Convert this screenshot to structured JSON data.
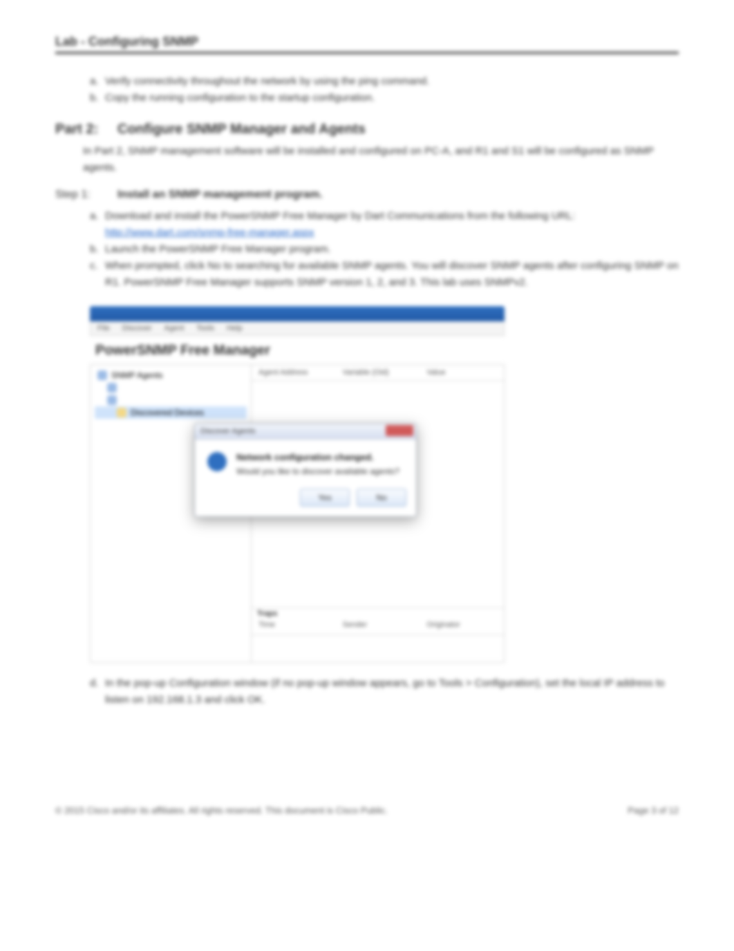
{
  "header": {
    "title": "Lab - Configuring SNMP"
  },
  "top_list": {
    "a": "Verify connectivity throughout the network by using the ping command.",
    "b": "Copy the running configuration to the startup configuration."
  },
  "part": {
    "label": "Part 2:",
    "title": "Configure SNMP Manager and Agents",
    "desc": "In Part 2, SNMP management software will be installed and configured on PC-A, and R1 and S1 will be configured as SNMP agents."
  },
  "step": {
    "label": "Step 1:",
    "title": "Install an SNMP management program."
  },
  "items": {
    "a": "Download and install the PowerSNMP Free Manager by Dart Communications from the following URL:",
    "link": "http://www.dart.com/snmp-free-manager.aspx",
    "b": "Launch the PowerSNMP Free Manager program.",
    "c": "When prompted, click No to searching for available SNMP agents. You will discover SNMP agents after configuring SNMP on R1. PowerSNMP Free Manager supports SNMP version 1, 2, and 3. This lab uses SNMPv2.",
    "d": "In the pop-up Configuration window (if no pop-up window appears, go to Tools > Configuration), set the local IP address to listen on 192.168.1.3 and click OK."
  },
  "app": {
    "menus": [
      "File",
      "Discover",
      "Agent",
      "Tools",
      "Help"
    ],
    "brand": "PowerSNMP Free Manager",
    "cols": [
      "Agent Address",
      "Variable (Oid)",
      "Value"
    ],
    "bottom_cols": [
      "Time",
      "Sender",
      "Originator"
    ],
    "bottom_hdr": "Traps",
    "tree0": "SNMP Agents",
    "tree1": "Discovered Devices"
  },
  "dialog": {
    "title": "Discover Agents",
    "line1": "Network configuration changed.",
    "line2": "Would you like to discover available agents?",
    "yes": "Yes",
    "no": "No"
  },
  "footer": {
    "left": "© 2015 Cisco and/or its affiliates. All rights reserved. This document is Cisco Public.",
    "right": "Page 3 of 12"
  }
}
